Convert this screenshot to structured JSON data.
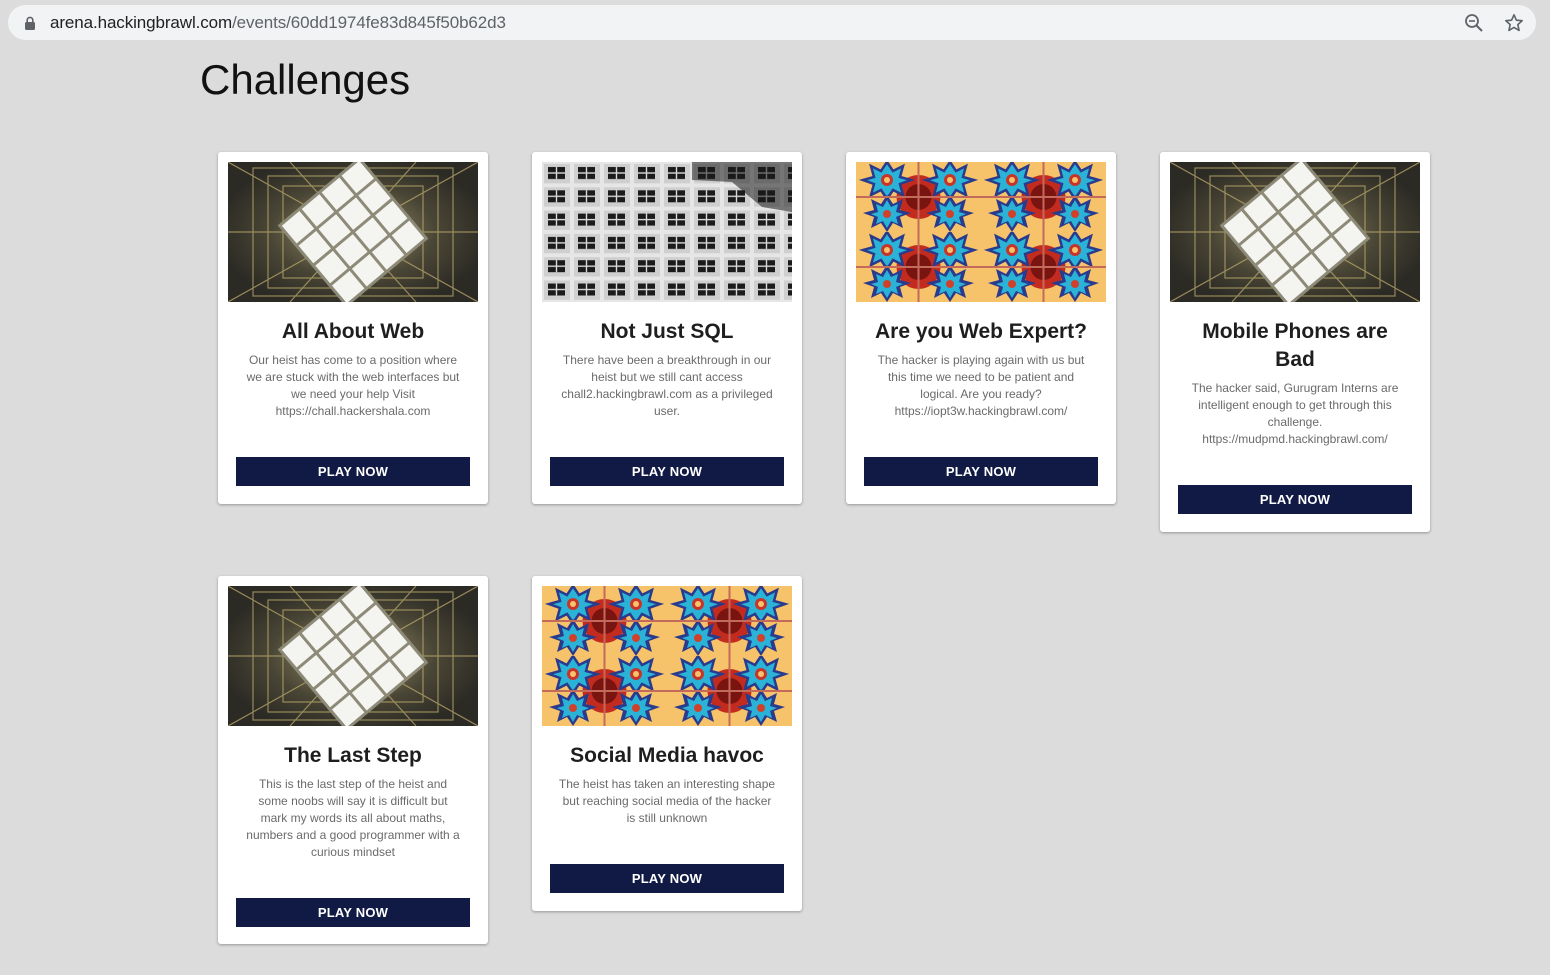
{
  "browser": {
    "url_host": "arena.hackingbrawl.com",
    "url_path": "/events/60dd1974fe83d845f50b62d3"
  },
  "page": {
    "title": "Challenges"
  },
  "challenges": [
    {
      "title": "All About Web",
      "description": "Our heist has come to a position where we are stuck with the web interfaces but we need your help Visit https://chall.hackershala.com",
      "button": "PLAY NOW",
      "image": "skylight-grid-image"
    },
    {
      "title": "Not Just SQL",
      "description": "There have been a breakthrough in our heist but we still cant access chall2.hackingbrawl.com as a privileged user.",
      "button": "PLAY NOW",
      "image": "building-windows-image"
    },
    {
      "title": "Are you Web Expert?",
      "description": "The hacker is playing again with us but this time we need to be patient and logical. Are you ready? https://iopt3w.hackingbrawl.com/",
      "button": "PLAY NOW",
      "image": "star-tile-pattern-image"
    },
    {
      "title": "Mobile Phones are Bad",
      "description": "The hacker said, Gurugram Interns are intelligent enough to get through this challenge. https://mudpmd.hackingbrawl.com/",
      "button": "PLAY NOW",
      "image": "skylight-grid-image"
    },
    {
      "title": "The Last Step",
      "description": "This is the last step of the heist and some noobs will say it is difficult but mark my words its all about maths, numbers and a good programmer with a curious mindset",
      "button": "PLAY NOW",
      "image": "skylight-grid-image"
    },
    {
      "title": "Social Media havoc",
      "description": "The heist has taken an interesting shape but reaching social media of the hacker is still unknown",
      "button": "PLAY NOW",
      "image": "star-tile-pattern-image"
    }
  ]
}
